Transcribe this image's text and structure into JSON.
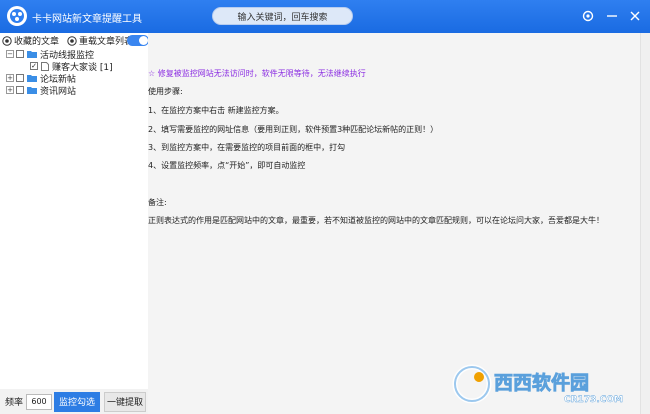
{
  "window": {
    "title": "卡卡网站新文章提醒工具"
  },
  "search": {
    "text": "输入关键词，回车搜索"
  },
  "toolbar": {
    "favorites": "收藏的文章",
    "reload": "重载文章列表"
  },
  "tree": {
    "items": [
      {
        "label": "活动线报监控",
        "expanded": true,
        "checked": false
      },
      {
        "label": "赚客大家谈 [1]",
        "checked": true
      },
      {
        "label": "论坛新帖",
        "expanded": false,
        "checked": false
      },
      {
        "label": "资讯网站",
        "expanded": false,
        "checked": false
      }
    ]
  },
  "bottom": {
    "freq_label": "频率",
    "freq_value": "600",
    "monitor_btn": "监控勾选",
    "extract_btn": "一键提取"
  },
  "content": {
    "notice": "☆ 修复被监控网站无法访问时，软件无限等待，无法继续执行",
    "usage_title": "使用步骤:",
    "step1": "1、在监控方案中右击 新建监控方案。",
    "step2": "2、填写需要监控的网址信息（要用到正则，软件预置3种匹配论坛新帖的正则！）",
    "step3": "3、到监控方案中，在需要监控的项目前面的框中，打勾",
    "step4": "4、设置监控频率，点“开始”，即可自动监控",
    "remark_title": "备注:",
    "remark": "正则表达式的作用是匹配网站中的文章，最重要，若不知道被监控的网站中的文章匹配规则，可以在论坛问大家，吾爱都是大牛！"
  },
  "watermark": {
    "brand": "西西软件园",
    "domain": "CR173.COM"
  },
  "colors": {
    "titlebar": "#2070e8",
    "accent": "#2d7de4",
    "notice": "#8a2be2"
  }
}
